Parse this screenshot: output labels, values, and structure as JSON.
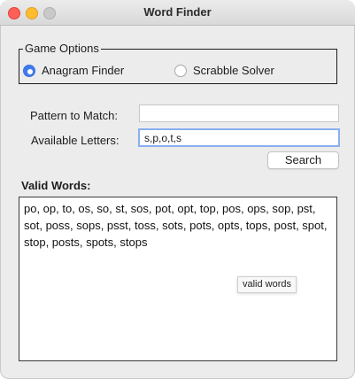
{
  "window": {
    "title": "Word Finder",
    "traffic_lights": [
      "close",
      "minimize",
      "zoom"
    ]
  },
  "game_options": {
    "legend": "Game Options",
    "options": [
      {
        "label": "Anagram Finder",
        "selected": true
      },
      {
        "label": "Scrabble Solver",
        "selected": false
      }
    ]
  },
  "form": {
    "pattern_label": "Pattern to Match:",
    "pattern_value": "",
    "letters_label": "Available Letters:",
    "letters_value": "s,p,o,t,s",
    "search_label": "Search"
  },
  "results": {
    "heading": "Valid Words:",
    "text": "po, op, to, os, so, st, sos, pot, opt, top, pos, ops, sop, pst, sot, poss, sops, psst, toss, sots, pots, opts, tops, post, spot, stop, posts, spots, stops",
    "tooltip": "valid words"
  },
  "colors": {
    "accent": "#3f7bf0",
    "focus_ring": "#8aaeef",
    "close": "#fe5f57",
    "minimize": "#febc2e",
    "zoom_disabled": "#c9c9c9"
  }
}
